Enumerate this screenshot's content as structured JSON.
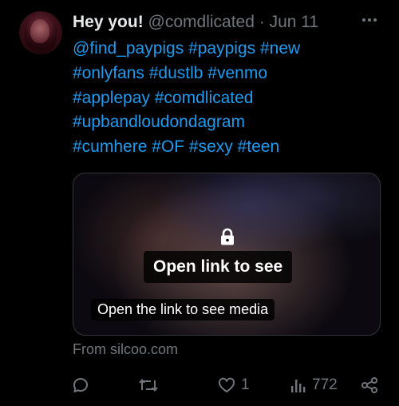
{
  "author": {
    "display_name": "Hey you!",
    "handle": "@comdlicated",
    "separator": "·",
    "date": "Jun 11"
  },
  "tweet": {
    "lines": [
      "@find_paypigs #paypigs #new",
      "#onlyfans #dustlb #venmo",
      "#applepay #comdlicated",
      "#upbandloudondagram",
      "#cumhere #OF #sexy #teen"
    ]
  },
  "card": {
    "overlay_label": "Open link to see",
    "caption": "Open the link to see media",
    "source": "From silcoo.com"
  },
  "actions": {
    "reply_count": "",
    "retweet_count": "",
    "like_count": "1",
    "views_count": "772"
  },
  "icons": {
    "more": "more-horizontal-icon",
    "lock": "lock-icon",
    "reply": "reply-icon",
    "retweet": "retweet-icon",
    "like": "heart-icon",
    "views": "analytics-icon",
    "share": "share-icon"
  },
  "colors": {
    "background": "#000000",
    "text": "#e7e9ea",
    "secondary": "#71767b",
    "link": "#1d9bf0",
    "border": "#333639"
  }
}
